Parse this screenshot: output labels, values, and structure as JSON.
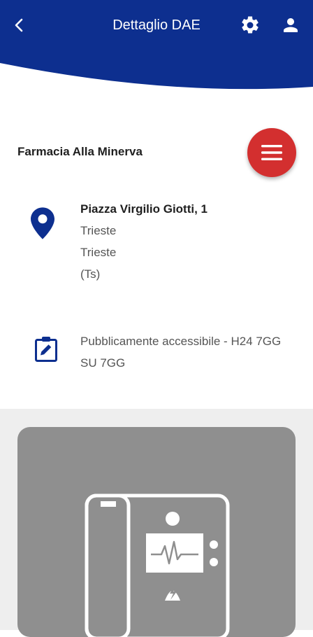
{
  "header": {
    "title": "Dettaglio DAE",
    "color": "#0d2f8f"
  },
  "place": {
    "name": "Farmacia Alla Minerva"
  },
  "address": {
    "street": "Piazza Virgilio Giotti, 1",
    "city": "Trieste",
    "municipality": "Trieste",
    "province": "(Ts)"
  },
  "access": {
    "text": "Pubblicamente accessibile - H24 7GG SU 7GG"
  },
  "icons": {
    "back": "back-arrow-icon",
    "settings": "gear-icon",
    "profile": "user-icon",
    "menu": "hamburger-menu-icon",
    "location": "map-pin-icon",
    "access": "clipboard-edit-icon",
    "device": "defibrillator-icon"
  },
  "colors": {
    "brand_blue": "#0d2f8f",
    "fab_red": "#d32f2f",
    "card_gray": "#8f8f8f"
  }
}
